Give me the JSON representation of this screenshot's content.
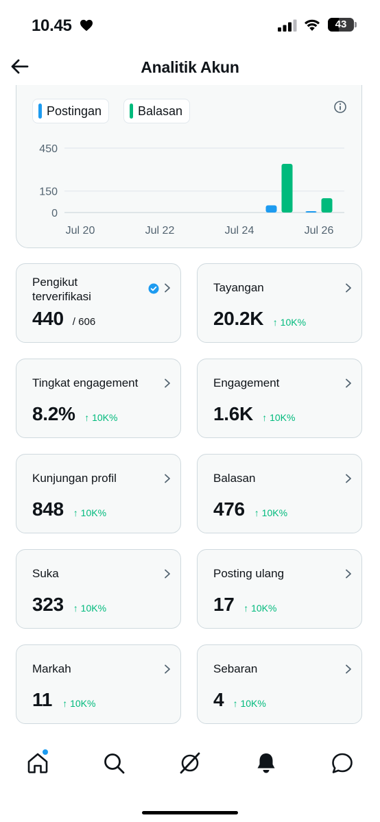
{
  "status": {
    "time": "10.45",
    "battery": "43"
  },
  "header": {
    "title": "Analitik Akun"
  },
  "legend": [
    {
      "label": "Postingan",
      "color": "#1d9bf0"
    },
    {
      "label": "Balasan",
      "color": "#00ba7c"
    }
  ],
  "chart_data": {
    "type": "bar",
    "x_ticks": [
      "Jul 20",
      "Jul 22",
      "Jul 24",
      "Jul 26"
    ],
    "y_ticks": [
      "450",
      "150",
      "0"
    ],
    "categories": [
      "Jul 20",
      "Jul 21",
      "Jul 22",
      "Jul 23",
      "Jul 24",
      "Jul 25",
      "Jul 26"
    ],
    "series": [
      {
        "name": "Postingan",
        "color": "#1d9bf0",
        "values": [
          0,
          0,
          0,
          0,
          0,
          50,
          8
        ]
      },
      {
        "name": "Balasan",
        "color": "#00ba7c",
        "values": [
          0,
          0,
          0,
          0,
          0,
          340,
          100
        ]
      }
    ],
    "ylim": [
      0,
      450
    ]
  },
  "stats": [
    {
      "label": "Pengikut terverifikasi",
      "value": "440",
      "sub": "/ 606",
      "verified": true
    },
    {
      "label": "Tayangan",
      "value": "20.2K",
      "change": "↑ 10K%"
    },
    {
      "label": "Tingkat engagement",
      "value": "8.2%",
      "change": "↑ 10K%"
    },
    {
      "label": "Engagement",
      "value": "1.6K",
      "change": "↑ 10K%"
    },
    {
      "label": "Kunjungan profil",
      "value": "848",
      "change": "↑ 10K%"
    },
    {
      "label": "Balasan",
      "value": "476",
      "change": "↑ 10K%"
    },
    {
      "label": "Suka",
      "value": "323",
      "change": "↑ 10K%"
    },
    {
      "label": "Posting ulang",
      "value": "17",
      "change": "↑ 10K%"
    },
    {
      "label": "Markah",
      "value": "11",
      "change": "↑ 10K%"
    },
    {
      "label": "Sebaran",
      "value": "4",
      "change": "↑ 10K%"
    }
  ],
  "tabs": [
    {
      "name": "home-icon",
      "active": true,
      "badge": true
    },
    {
      "name": "search-icon"
    },
    {
      "name": "grok-icon"
    },
    {
      "name": "notifications-icon",
      "active": true
    },
    {
      "name": "messages-icon"
    }
  ]
}
